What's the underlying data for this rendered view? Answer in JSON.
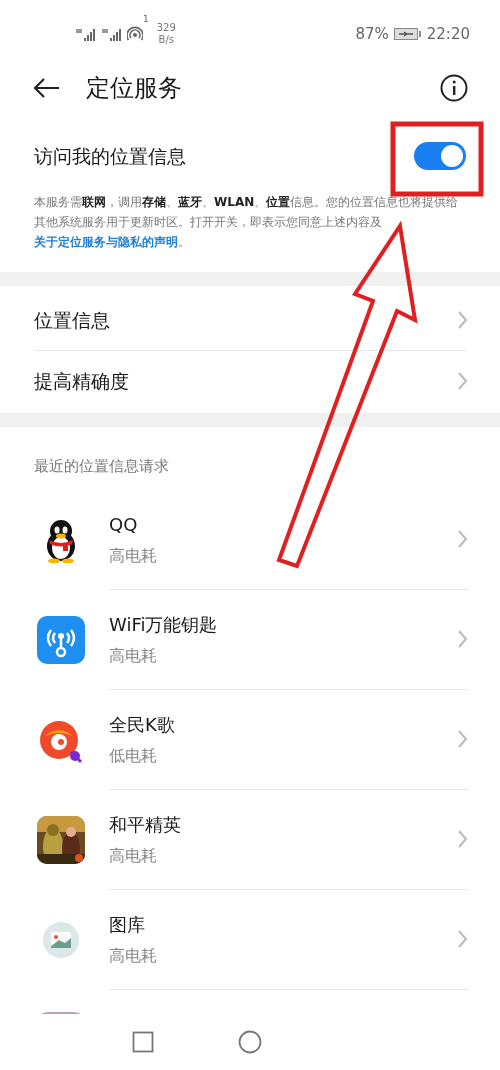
{
  "status_bar": {
    "speed_value": "329",
    "speed_unit": "B/s",
    "battery": "87%",
    "time": "22:20",
    "sim_badge": "1"
  },
  "header": {
    "title": "定位服务"
  },
  "location_access": {
    "label": "访问我的位置信息",
    "on": true
  },
  "description": {
    "text": "本服务需**联网**，调用**存储**、**蓝牙**、**WLAN**、**位置**信息。您的位置信息也将提供给其他系统服务用于更新时区。打开开关，即表示您同意上述内容及",
    "link": "关于定位服务与隐私的声明",
    "end": "。"
  },
  "settings": [
    {
      "label": "位置信息"
    },
    {
      "label": "提高精确度"
    }
  ],
  "recent_requests": {
    "heading": "最近的位置信息请求",
    "apps": [
      {
        "name": "QQ",
        "usage": "高电耗",
        "kind": "penguin"
      },
      {
        "name": "WiFi万能钥匙",
        "usage": "高电耗",
        "kind": "wifi-key"
      },
      {
        "name": "全民K歌",
        "usage": "低电耗",
        "kind": "karaoke"
      },
      {
        "name": "和平精英",
        "usage": "高电耗",
        "kind": "picture"
      },
      {
        "name": "图库",
        "usage": "高电耗",
        "kind": "gallery"
      },
      {
        "kind": "cut-off"
      }
    ]
  },
  "annotation": {
    "highlight_box": true,
    "arrow": true
  }
}
